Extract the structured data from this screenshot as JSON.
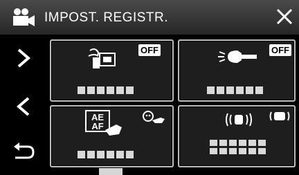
{
  "header": {
    "title": "IMPOST. REGISTR.",
    "camera_icon": "video-camera-icon",
    "close_icon": "close-x-icon"
  },
  "sidebar": {
    "next_icon": "chevron-right-icon",
    "prev_icon": "chevron-left-icon",
    "back_icon": "return-arrow-icon"
  },
  "tiles": [
    {
      "icon": "wind-cut-microphone-icon",
      "value": "OFF"
    },
    {
      "icon": "video-light-icon",
      "value": "OFF"
    },
    {
      "icon": "ae-af-touch-icon",
      "secondary_icon": "face-tracking-icon"
    },
    {
      "icon": "zoom-mic-icon",
      "secondary_icon": "zoom-mic-level-icon"
    }
  ],
  "colors": {
    "header_top": "#4a4a4a",
    "header_bottom": "#262626",
    "tile_bg": "#1e1e1e",
    "tile_border": "#bdbdbd"
  }
}
